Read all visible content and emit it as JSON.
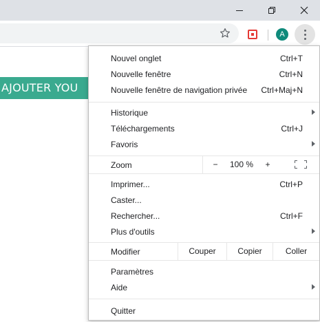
{
  "window_controls": {
    "minimize_icon": "minimize-icon",
    "maximize_icon": "restore-icon",
    "close_icon": "close-icon"
  },
  "toolbar": {
    "bookmark_icon": "star-icon",
    "extension_icon": "extension-icon",
    "avatar_letter": "A",
    "avatar_color": "#0f8a7b",
    "menu_icon": "more-vert-icon"
  },
  "page": {
    "button_text": "AJOUTER YOU",
    "button_color": "#3aaa8f"
  },
  "menu": {
    "new_tab": {
      "label": "Nouvel onglet",
      "shortcut": "Ctrl+T"
    },
    "new_window": {
      "label": "Nouvelle fenêtre",
      "shortcut": "Ctrl+N"
    },
    "incognito": {
      "label": "Nouvelle fenêtre de navigation privée",
      "shortcut": "Ctrl+Maj+N"
    },
    "history": {
      "label": "Historique"
    },
    "downloads": {
      "label": "Téléchargements",
      "shortcut": "Ctrl+J"
    },
    "bookmarks": {
      "label": "Favoris"
    },
    "zoom": {
      "label": "Zoom",
      "minus": "−",
      "value": "100 %",
      "plus": "+"
    },
    "print": {
      "label": "Imprimer...",
      "shortcut": "Ctrl+P"
    },
    "cast": {
      "label": "Caster..."
    },
    "find": {
      "label": "Rechercher...",
      "shortcut": "Ctrl+F"
    },
    "more_tools": {
      "label": "Plus d'outils"
    },
    "edit": {
      "label": "Modifier",
      "cut": "Couper",
      "copy": "Copier",
      "paste": "Coller"
    },
    "settings": {
      "label": "Paramètres"
    },
    "help": {
      "label": "Aide"
    },
    "quit": {
      "label": "Quitter"
    }
  }
}
